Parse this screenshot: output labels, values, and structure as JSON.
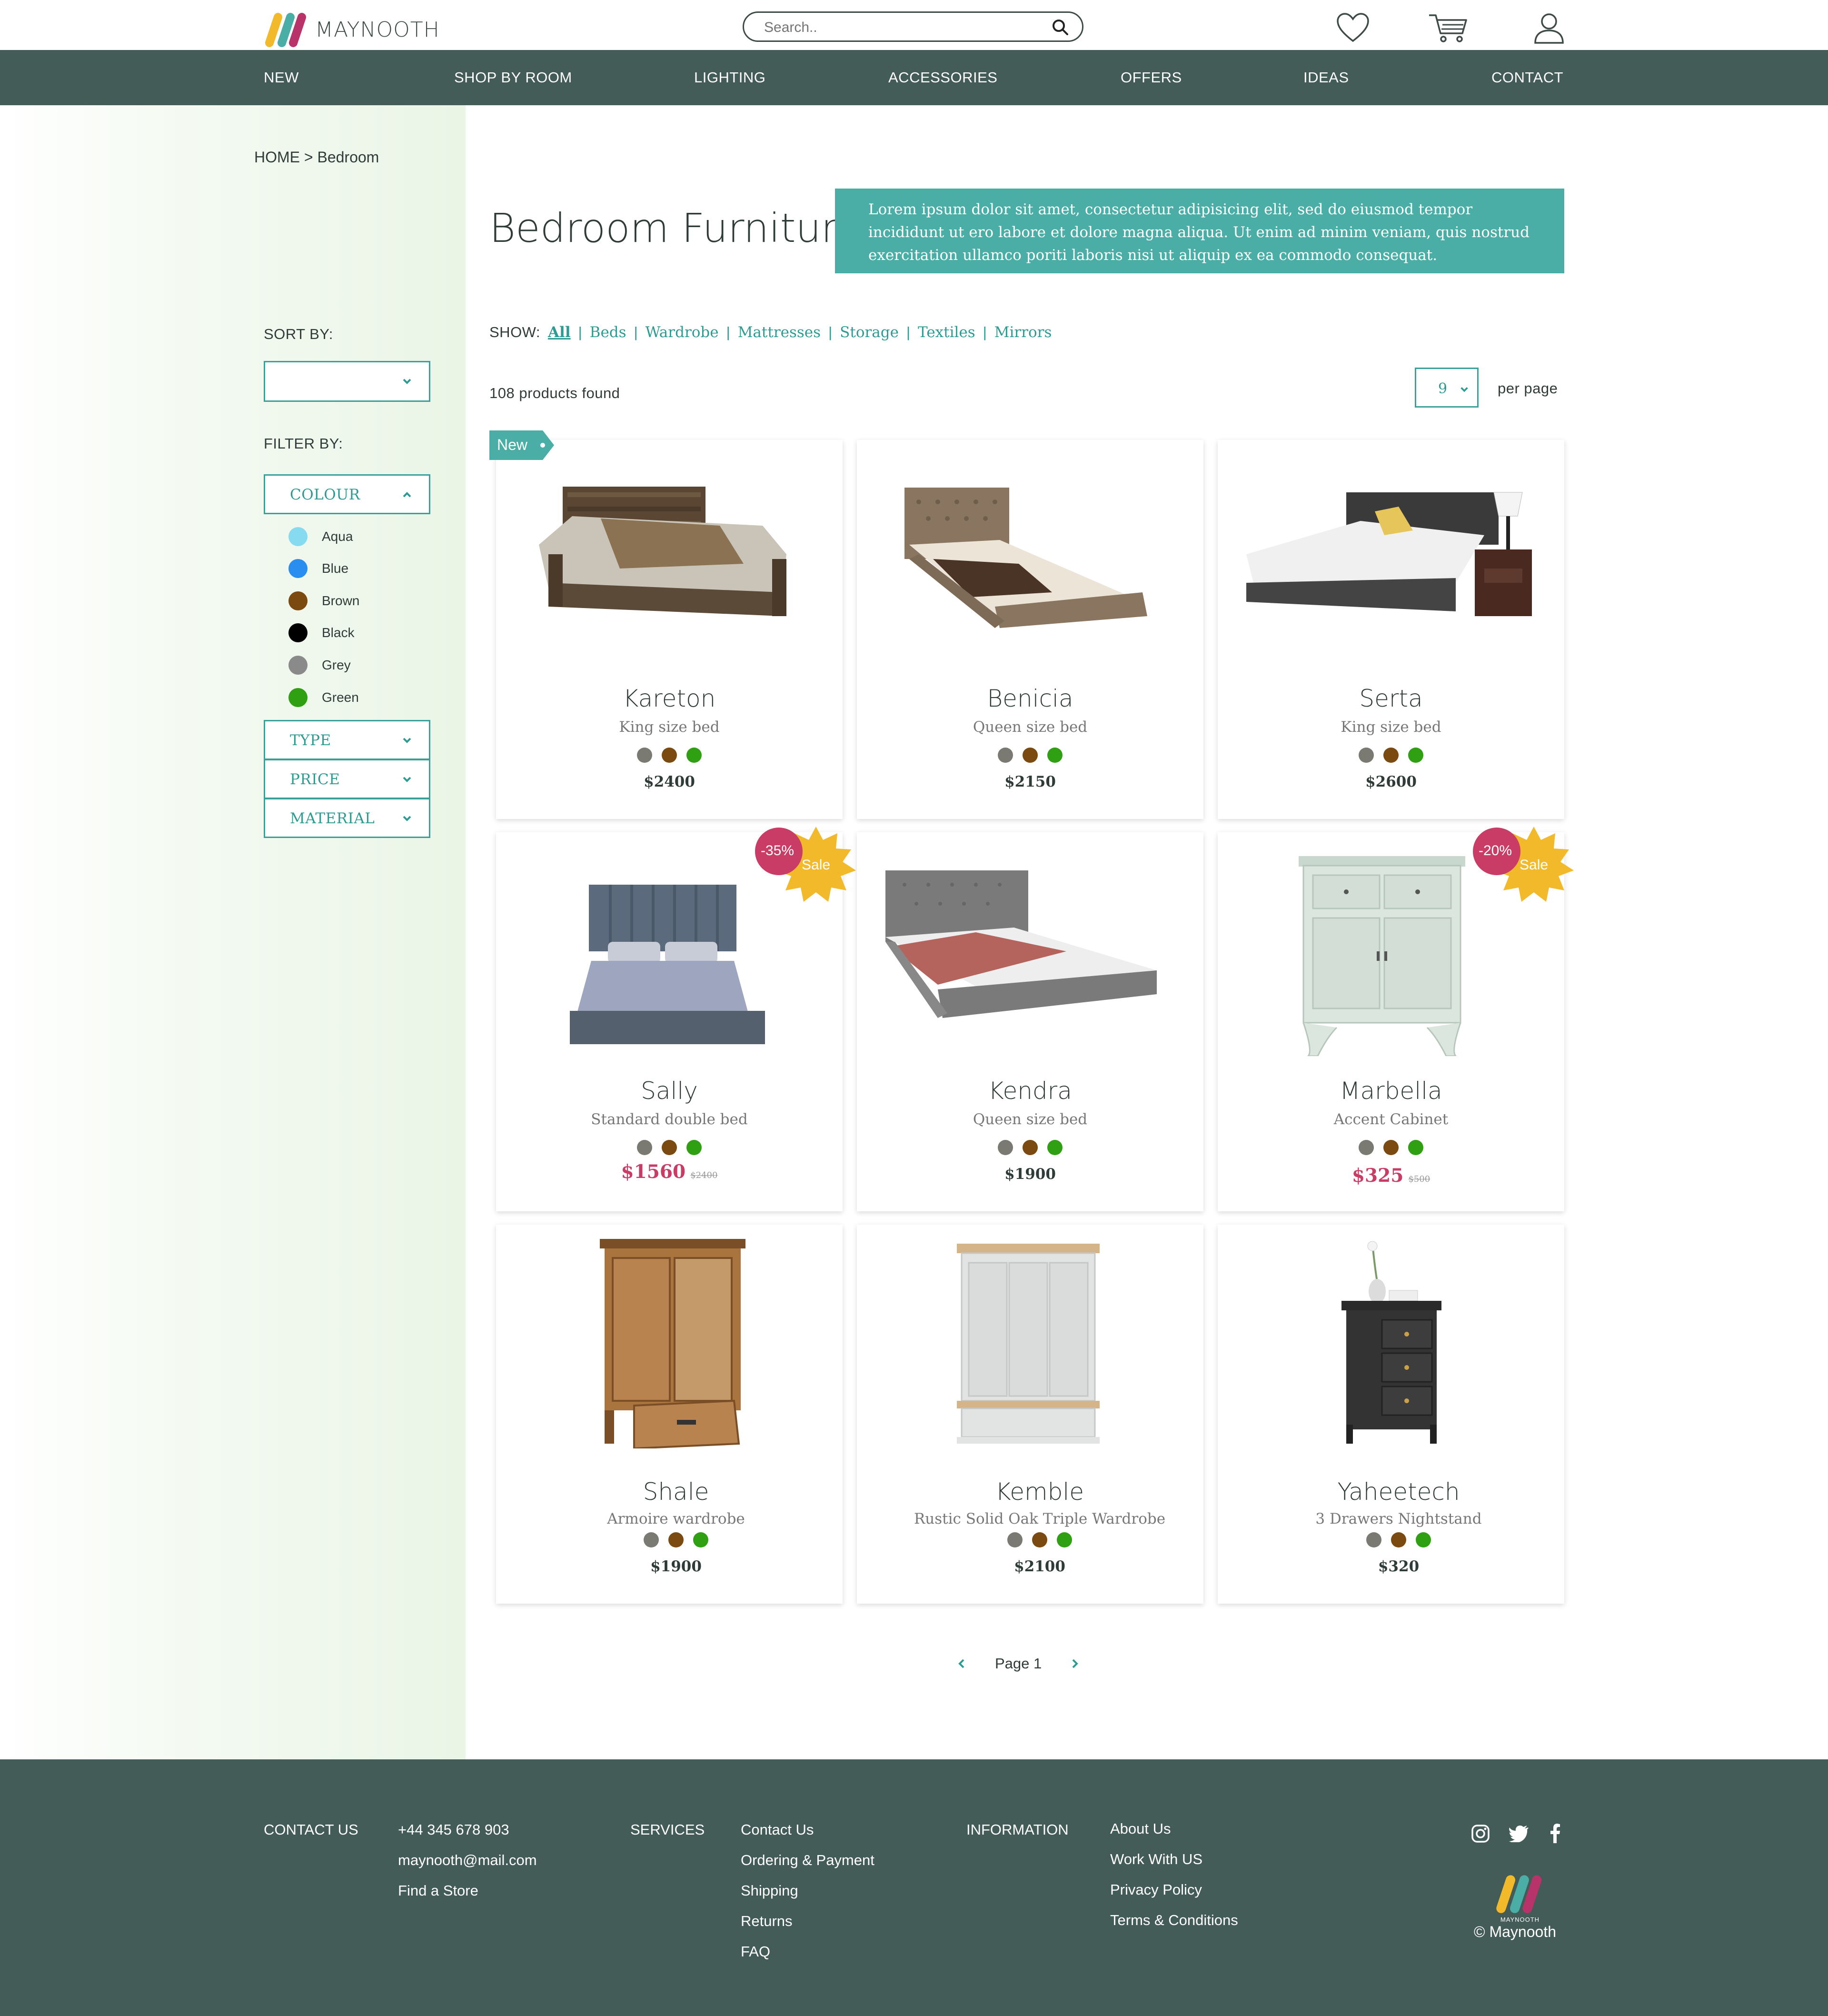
{
  "brand": {
    "name": "MAYNOOTH"
  },
  "search": {
    "placeholder": "Search.."
  },
  "header_icons": [
    "heart-icon",
    "cart-icon",
    "user-icon"
  ],
  "nav": [
    "NEW",
    "SHOP BY ROOM",
    "LIGHTING",
    "ACCESSORIES",
    "OFFERS",
    "IDEAS",
    "CONTACT"
  ],
  "breadcrumb": "HOME > Bedroom",
  "page": {
    "title": "Bedroom Furniture",
    "intro": "Lorem ipsum dolor sit amet, consectetur adipisicing elit, sed do eiusmod tempor incididunt ut ero labore et dolore magna aliqua. Ut enim ad minim veniam, quis nostrud exercitation ullamco poriti laboris nisi ut aliquip ex ea commodo consequat."
  },
  "sort": {
    "label": "SORT BY:",
    "value": ""
  },
  "filter": {
    "label": "FILTER BY:",
    "colour": {
      "label": "COLOUR",
      "options": [
        {
          "name": "Aqua",
          "color": "#86dbf0"
        },
        {
          "name": "Blue",
          "color": "#2a8ef0"
        },
        {
          "name": "Brown",
          "color": "#7a4a10"
        },
        {
          "name": "Black",
          "color": "#000000"
        },
        {
          "name": "Grey",
          "color": "#8a8a8a"
        },
        {
          "name": "Green",
          "color": "#2ea012"
        }
      ]
    },
    "type": "TYPE",
    "price": "PRICE",
    "material": "MATERIAL"
  },
  "show": {
    "label": "SHOW:",
    "categories": [
      "All",
      "Beds",
      "Wardrobe",
      "Mattresses",
      "Storage",
      "Textiles",
      "Mirrors"
    ]
  },
  "results": {
    "count_text": "108 products found",
    "per_page_value": "9",
    "per_page_label": "per page"
  },
  "swatch_colors": [
    "#7a7a72",
    "#7a4a10",
    "#2ea012"
  ],
  "accent": "#4aaea6",
  "sale_color": "#c83c66",
  "products": [
    {
      "name": "Kareton",
      "subtitle": "King size bed",
      "price": "$2400",
      "badge": "New"
    },
    {
      "name": "Benicia",
      "subtitle": "Queen size bed",
      "price": "$2150"
    },
    {
      "name": "Serta",
      "subtitle": "King size bed",
      "price": "$2600"
    },
    {
      "name": "Sally",
      "subtitle": "Standard double bed",
      "price": "$1560",
      "old_price": "$2400",
      "discount": "-35%",
      "sale_label": "Sale"
    },
    {
      "name": "Kendra",
      "subtitle": "Queen size bed",
      "price": "$1900"
    },
    {
      "name": "Marbella",
      "subtitle": "Accent Cabinet",
      "price": "$325",
      "old_price": "$500",
      "discount": "-20%",
      "sale_label": "Sale"
    },
    {
      "name": "Shale",
      "subtitle": "Armoire wardrobe",
      "price": "$1900"
    },
    {
      "name": "Kemble",
      "subtitle": "Rustic Solid Oak Triple Wardrobe",
      "price": "$2100"
    },
    {
      "name": "Yaheetech",
      "subtitle": "3 Drawers Nightstand",
      "price": "$320"
    }
  ],
  "pagination": {
    "label": "Page 1"
  },
  "footer": {
    "contact": {
      "title": "CONTACT US",
      "items": [
        "+44 345 678 903",
        "maynooth@mail.com",
        "Find a Store"
      ]
    },
    "services": {
      "title": "SERVICES",
      "items": [
        "Contact Us",
        "Ordering & Payment",
        "Shipping",
        "Returns",
        "FAQ"
      ]
    },
    "information": {
      "title": "INFORMATION",
      "items": [
        "About Us",
        "Work With US",
        "Privacy Policy",
        "Terms & Conditions"
      ]
    },
    "social": [
      "instagram-icon",
      "twitter-icon",
      "facebook-icon"
    ],
    "logo_text": "MAYNOOTH",
    "copyright": "© Maynooth"
  }
}
